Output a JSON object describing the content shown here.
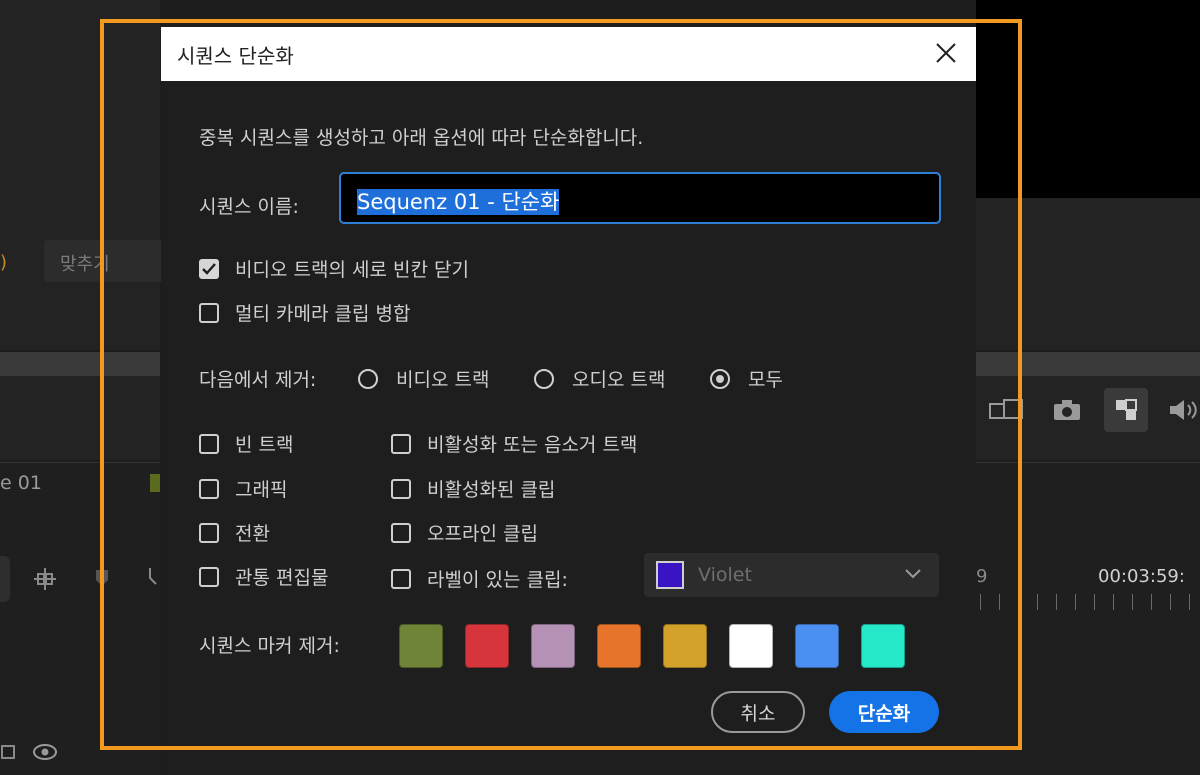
{
  "background": {
    "fit_dropdown_label": "맞추기",
    "sequence_tab_label": "e 01",
    "timecode": "00:03:59:",
    "timecode_prefix": "9"
  },
  "dialog": {
    "title": "시퀀스 단순화",
    "description": "중복 시퀀스를 생성하고 아래 옵션에 따라 단순화합니다.",
    "name_label": "시퀀스 이름:",
    "name_value": "Sequenz 01 - 단순화",
    "options": {
      "close_gaps": {
        "label": "비디오 트랙의 세로 빈칸 닫기",
        "checked": true
      },
      "merge_multicam": {
        "label": "멀티 카메라 클립 병합",
        "checked": false
      }
    },
    "remove_from": {
      "label": "다음에서 제거:",
      "choices": [
        {
          "label": "비디오 트랙",
          "selected": false
        },
        {
          "label": "오디오 트랙",
          "selected": false
        },
        {
          "label": "모두",
          "selected": true
        }
      ]
    },
    "remove_items_left": [
      {
        "label": "빈 트랙",
        "checked": false
      },
      {
        "label": "그래픽",
        "checked": false
      },
      {
        "label": "전환",
        "checked": false
      },
      {
        "label": "관통 편집물",
        "checked": false
      }
    ],
    "remove_items_right": [
      {
        "label": "비활성화 또는 음소거 트랙",
        "checked": false
      },
      {
        "label": "비활성화된 클립",
        "checked": false
      },
      {
        "label": "오프라인 클립",
        "checked": false
      },
      {
        "label": "라벨이 있는 클립:",
        "checked": false
      }
    ],
    "label_select": {
      "value": "Violet",
      "color": "#3a14c2"
    },
    "marker_label": "시퀀스 마커 제거:",
    "marker_colors": [
      "#6f8436",
      "#d5353b",
      "#b592b5",
      "#e6742a",
      "#d4a22b",
      "#ffffff",
      "#4b8ff0",
      "#25e8c8"
    ],
    "cancel_label": "취소",
    "ok_label": "단순화"
  },
  "accent_color": "#1473e6",
  "highlight_color": "#f29a1f"
}
